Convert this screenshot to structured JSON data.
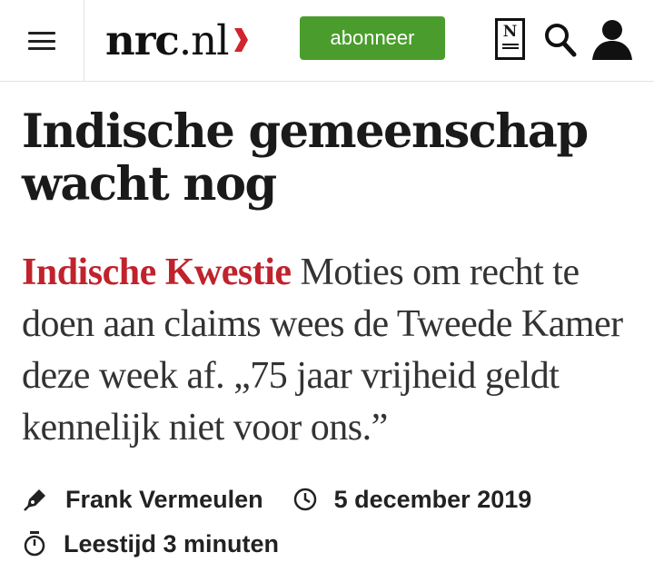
{
  "header": {
    "menu_icon": "hamburger-icon",
    "logo": {
      "bold": "nrc",
      "rest": ".nl"
    },
    "subscribe_label": "abonneer",
    "newspaper_icon_letter": "N",
    "icons": [
      "hamburger-icon",
      "newspaper-icon",
      "search-icon",
      "account-icon"
    ]
  },
  "article": {
    "headline": "Indische gemeenschap wacht nog",
    "kicker": "Indische Kwestie",
    "intro": "Moties om recht te doen aan claims wees de Tweede Kamer deze week af. „75 jaar vrijheid geldt kennelijk niet voor ons.”",
    "author": "Frank Vermeulen",
    "date": "5 december 2019",
    "reading_time": "Leestijd 3 minuten"
  },
  "colors": {
    "brand_red": "#c0232c",
    "subscribe_green": "#4a9d2c",
    "text": "#1a1a1a"
  }
}
